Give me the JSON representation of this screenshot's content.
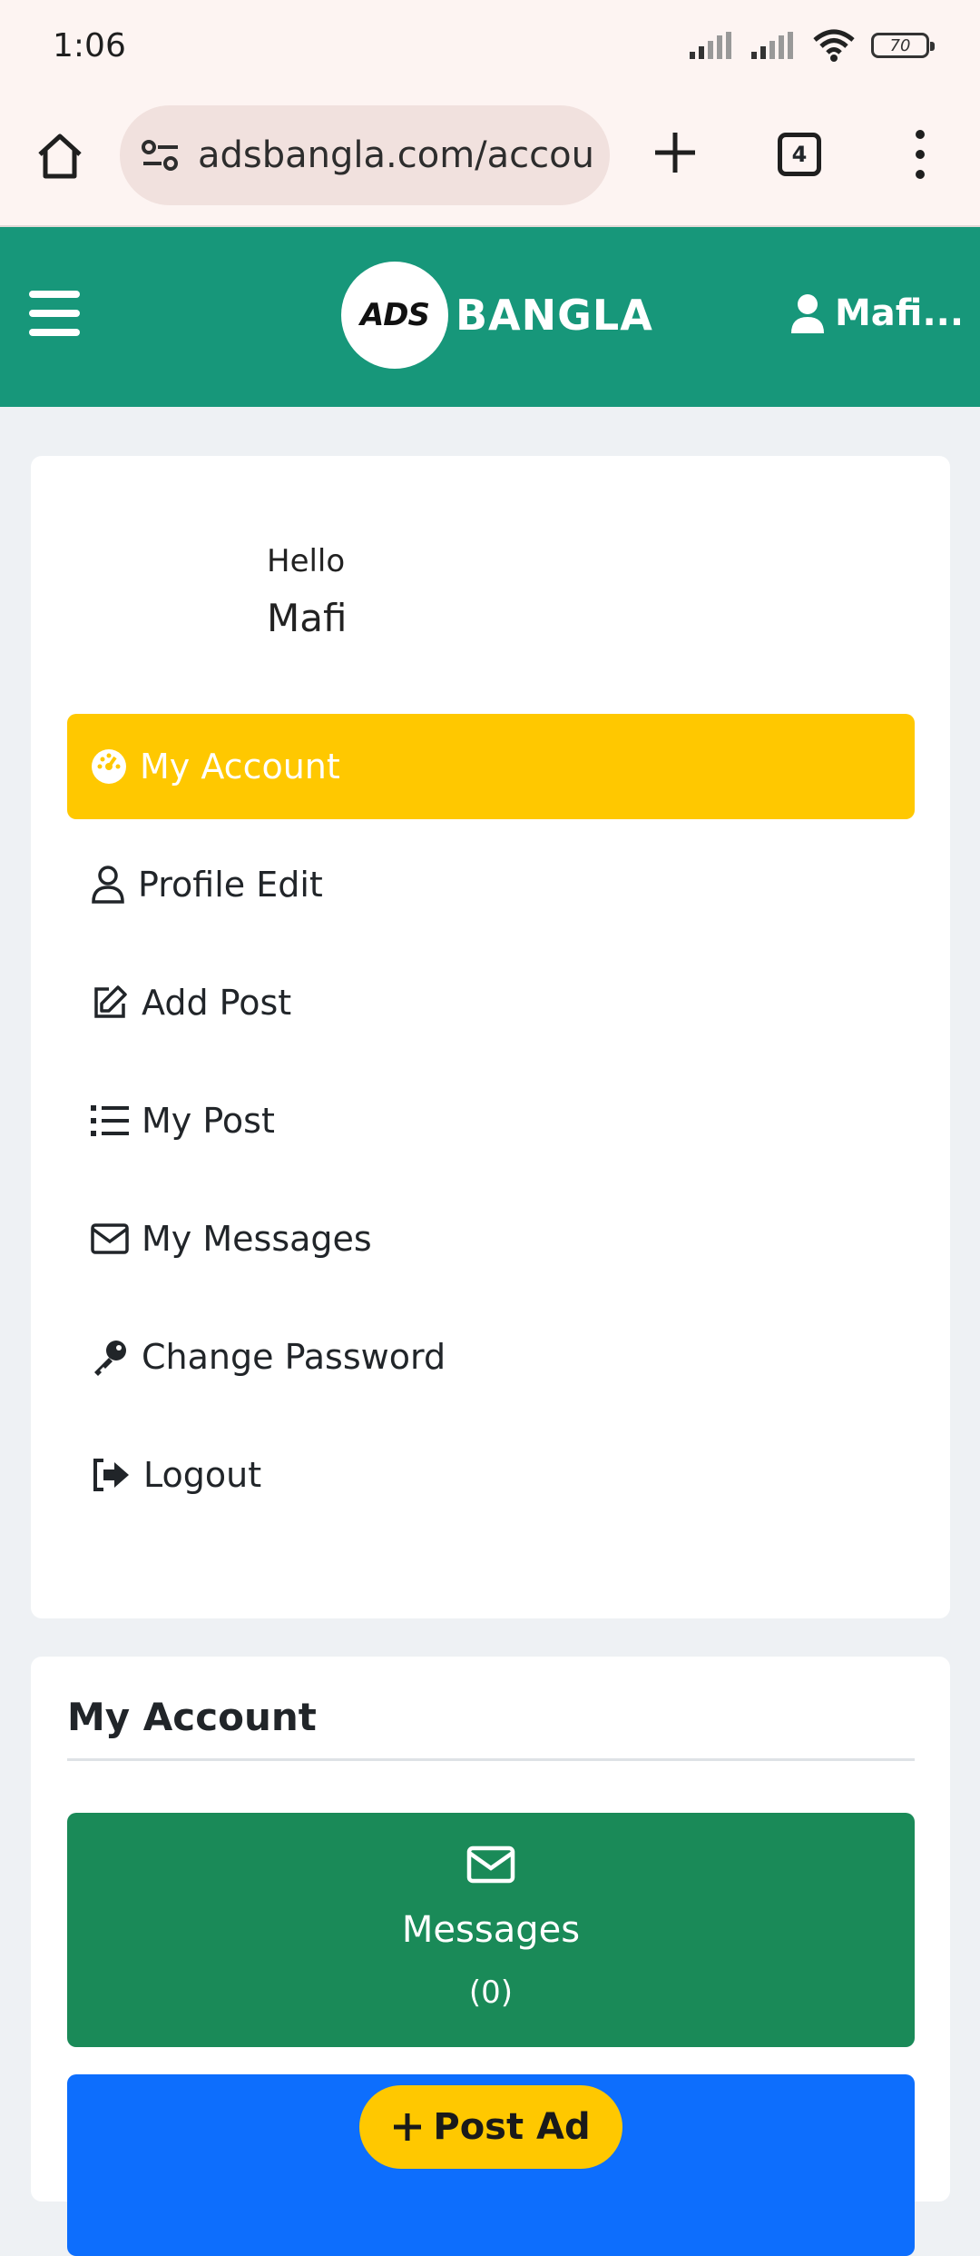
{
  "status_bar": {
    "time": "1:06",
    "battery": "70"
  },
  "browser": {
    "url": "adsbangla.com/accou",
    "tab_count": "4"
  },
  "header": {
    "logo_mark": "ADS",
    "logo_text": "BANGLA",
    "user_name": "Mafi..."
  },
  "profile": {
    "greeting": "Hello",
    "name": "Mafi"
  },
  "menu": [
    {
      "label": "My Account",
      "icon": "dashboard-icon",
      "active": true
    },
    {
      "label": "Profile Edit",
      "icon": "user-icon",
      "active": false
    },
    {
      "label": "Add Post",
      "icon": "edit-icon",
      "active": false
    },
    {
      "label": "My Post",
      "icon": "list-icon",
      "active": false
    },
    {
      "label": "My Messages",
      "icon": "envelope-icon",
      "active": false
    },
    {
      "label": "Change Password",
      "icon": "key-icon",
      "active": false
    },
    {
      "label": "Logout",
      "icon": "logout-icon",
      "active": false
    }
  ],
  "account_section": {
    "title": "My Account",
    "messages_label": "Messages",
    "messages_count": "(0)"
  },
  "floating": {
    "post_ad_label": "Post Ad"
  },
  "colors": {
    "header_green": "#17977a",
    "active_yellow": "#ffc800",
    "messages_green": "#1a8a58",
    "blue_tile": "#0d6efd"
  }
}
